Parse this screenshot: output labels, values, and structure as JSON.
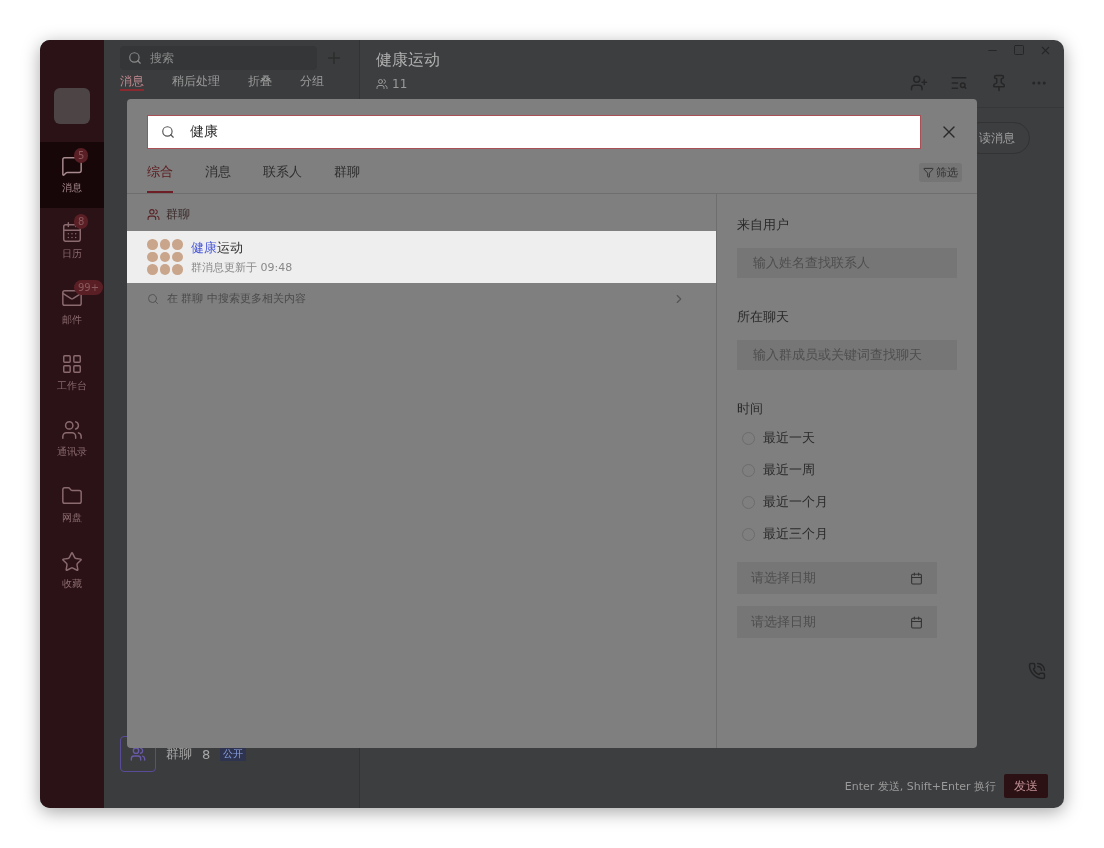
{
  "sidebar": {
    "items": [
      {
        "label": "消息",
        "badge": "5",
        "selected": true
      },
      {
        "label": "日历",
        "badge": "8",
        "selected": false
      },
      {
        "label": "邮件",
        "badge": "99+",
        "selected": false
      },
      {
        "label": "工作台",
        "selected": false
      },
      {
        "label": "通讯录",
        "selected": false
      },
      {
        "label": "网盘",
        "selected": false
      },
      {
        "label": "收藏",
        "selected": false
      }
    ]
  },
  "conversation_list": {
    "search_placeholder": "搜索",
    "tabs": [
      {
        "label": "消息",
        "selected": true
      },
      {
        "label": "稍后处理",
        "selected": false
      },
      {
        "label": "折叠",
        "selected": false
      },
      {
        "label": "分组",
        "selected": false
      }
    ],
    "items": [
      {
        "name": "群聊",
        "count": "8",
        "tag": "公开"
      }
    ]
  },
  "chat": {
    "title": "健康运动",
    "member_count": "11",
    "unread_button": "读消息",
    "input_hint": "Enter 发送, Shift+Enter 换行",
    "send_button": "发送"
  },
  "search_dialog": {
    "query": "健康",
    "tabs": [
      {
        "label": "综合",
        "selected": true
      },
      {
        "label": "消息",
        "selected": false
      },
      {
        "label": "联系人",
        "selected": false
      },
      {
        "label": "群聊",
        "selected": false
      }
    ],
    "filter_button": "筛选",
    "sections": [
      {
        "title": "群聊",
        "results": [
          {
            "title_match": "健康",
            "title_rest": "运动",
            "subtitle": "群消息更新于 09:48",
            "selected": true
          }
        ],
        "more": "在 群聊 中搜索更多相关内容"
      }
    ],
    "filters": {
      "from_user": {
        "label": "来自用户",
        "placeholder": "输入姓名查找联系人"
      },
      "in_chat": {
        "label": "所在聊天",
        "placeholder": "输入群成员或关键词查找聊天"
      },
      "time": {
        "label": "时间",
        "options": [
          {
            "label": "最近一天",
            "selected": false
          },
          {
            "label": "最近一周",
            "selected": false
          },
          {
            "label": "最近一个月",
            "selected": false
          },
          {
            "label": "最近三个月",
            "selected": false
          }
        ],
        "date_fields": [
          {
            "placeholder": "请选择日期"
          },
          {
            "placeholder": "请选择日期"
          }
        ]
      }
    }
  }
}
